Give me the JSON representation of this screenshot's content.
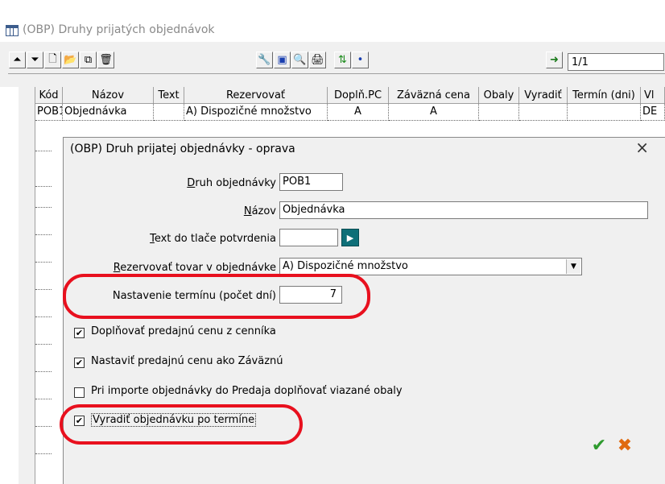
{
  "window": {
    "title": "(OBP) Druhy prijatých objednávok"
  },
  "toolbar": {
    "icons": [
      "first-record-icon",
      "last-record-icon",
      "new-document-icon",
      "open-folder-icon",
      "copy-icon",
      "delete-icon",
      "wrench-icon",
      "monitor-icon",
      "search-icon",
      "print-icon",
      "export-icon",
      "info-icon",
      "exit-icon"
    ],
    "page_indicator": "1/1"
  },
  "grid": {
    "columns": [
      "Kód",
      "Názov",
      "Text",
      "Rezervovať",
      "Doplň.PC",
      "Záväzná cena",
      "Obaly",
      "Vyradiť",
      "Termín (dni)",
      "Vl"
    ],
    "rows": [
      [
        "POB1",
        "Objednávka",
        "",
        "A) Dispozičné množstvo",
        "A",
        "A",
        "",
        "",
        "",
        "DE"
      ]
    ]
  },
  "dialog": {
    "title": "(OBP) Druh prijatej objednávky - oprava",
    "close_symbol": "×",
    "fields": {
      "druh_label_pre": "",
      "druh_label_u": "D",
      "druh_label_post": "ruh objednávky",
      "druh_value": "POB1",
      "nazov_label_u": "N",
      "nazov_label_post": "ázov",
      "nazov_value": "Objednávka",
      "text_label_u": "T",
      "text_label_post": "ext do tlače potvrdenia",
      "text_value": "",
      "rezervovat_label_u": "R",
      "rezervovat_label_post": "ezervovať tovar v objednávke",
      "rezervovat_value": "A) Dispozičné množstvo",
      "termin_label": "Nastavenie termínu (počet dní)",
      "termin_value": "7"
    },
    "checkboxes": [
      {
        "label": "Doplňovať predajnú cenu z cenníka",
        "checked": true,
        "mark": "✔"
      },
      {
        "label": "Nastaviť predajnú cenu ako Záväznú",
        "checked": true,
        "mark": "✔"
      },
      {
        "label": "Pri importe objednávky do Predaja doplňovať viazané obaly",
        "checked": false,
        "mark": ""
      },
      {
        "label": "Vyradiť objednávku po termíne",
        "checked": true,
        "mark": "✔"
      }
    ],
    "buttons": {
      "ok_symbol": "✔",
      "cancel_symbol": "✖"
    }
  },
  "colors": {
    "highlight": "#e8101e",
    "ok": "#2e9a2e",
    "cancel": "#e06a10",
    "arrow_button": "#0e6f78"
  }
}
